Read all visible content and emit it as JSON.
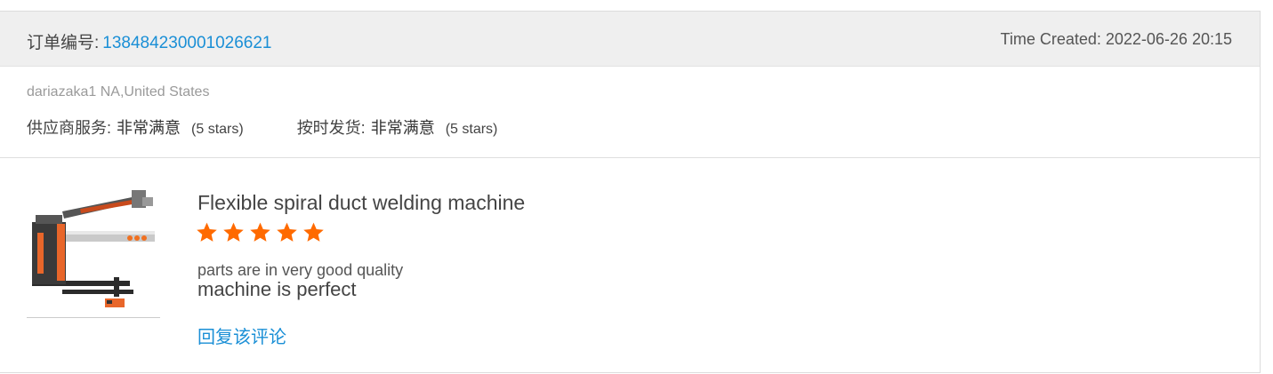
{
  "order": {
    "label": "订单编号:",
    "number": "138484230001026621",
    "time_created": "Time Created: 2022-06-26 20:15"
  },
  "buyer": {
    "info": "dariazaka1 NA,United States"
  },
  "ratings": [
    {
      "label": "供应商服务:",
      "value": "非常满意",
      "stars_text": "(5 stars)"
    },
    {
      "label": "按时发货:",
      "value": "非常满意",
      "stars_text": "(5 stars)"
    }
  ],
  "review": {
    "product_title": "Flexible spiral duct welding machine",
    "rating": 5,
    "line1": "parts are in very good quality",
    "line2": "machine is perfect",
    "reply_label": "回复该评论",
    "star_color": "#ff6a00"
  },
  "colors": {
    "link": "#1a8fd6",
    "header_bg": "#efefef"
  }
}
